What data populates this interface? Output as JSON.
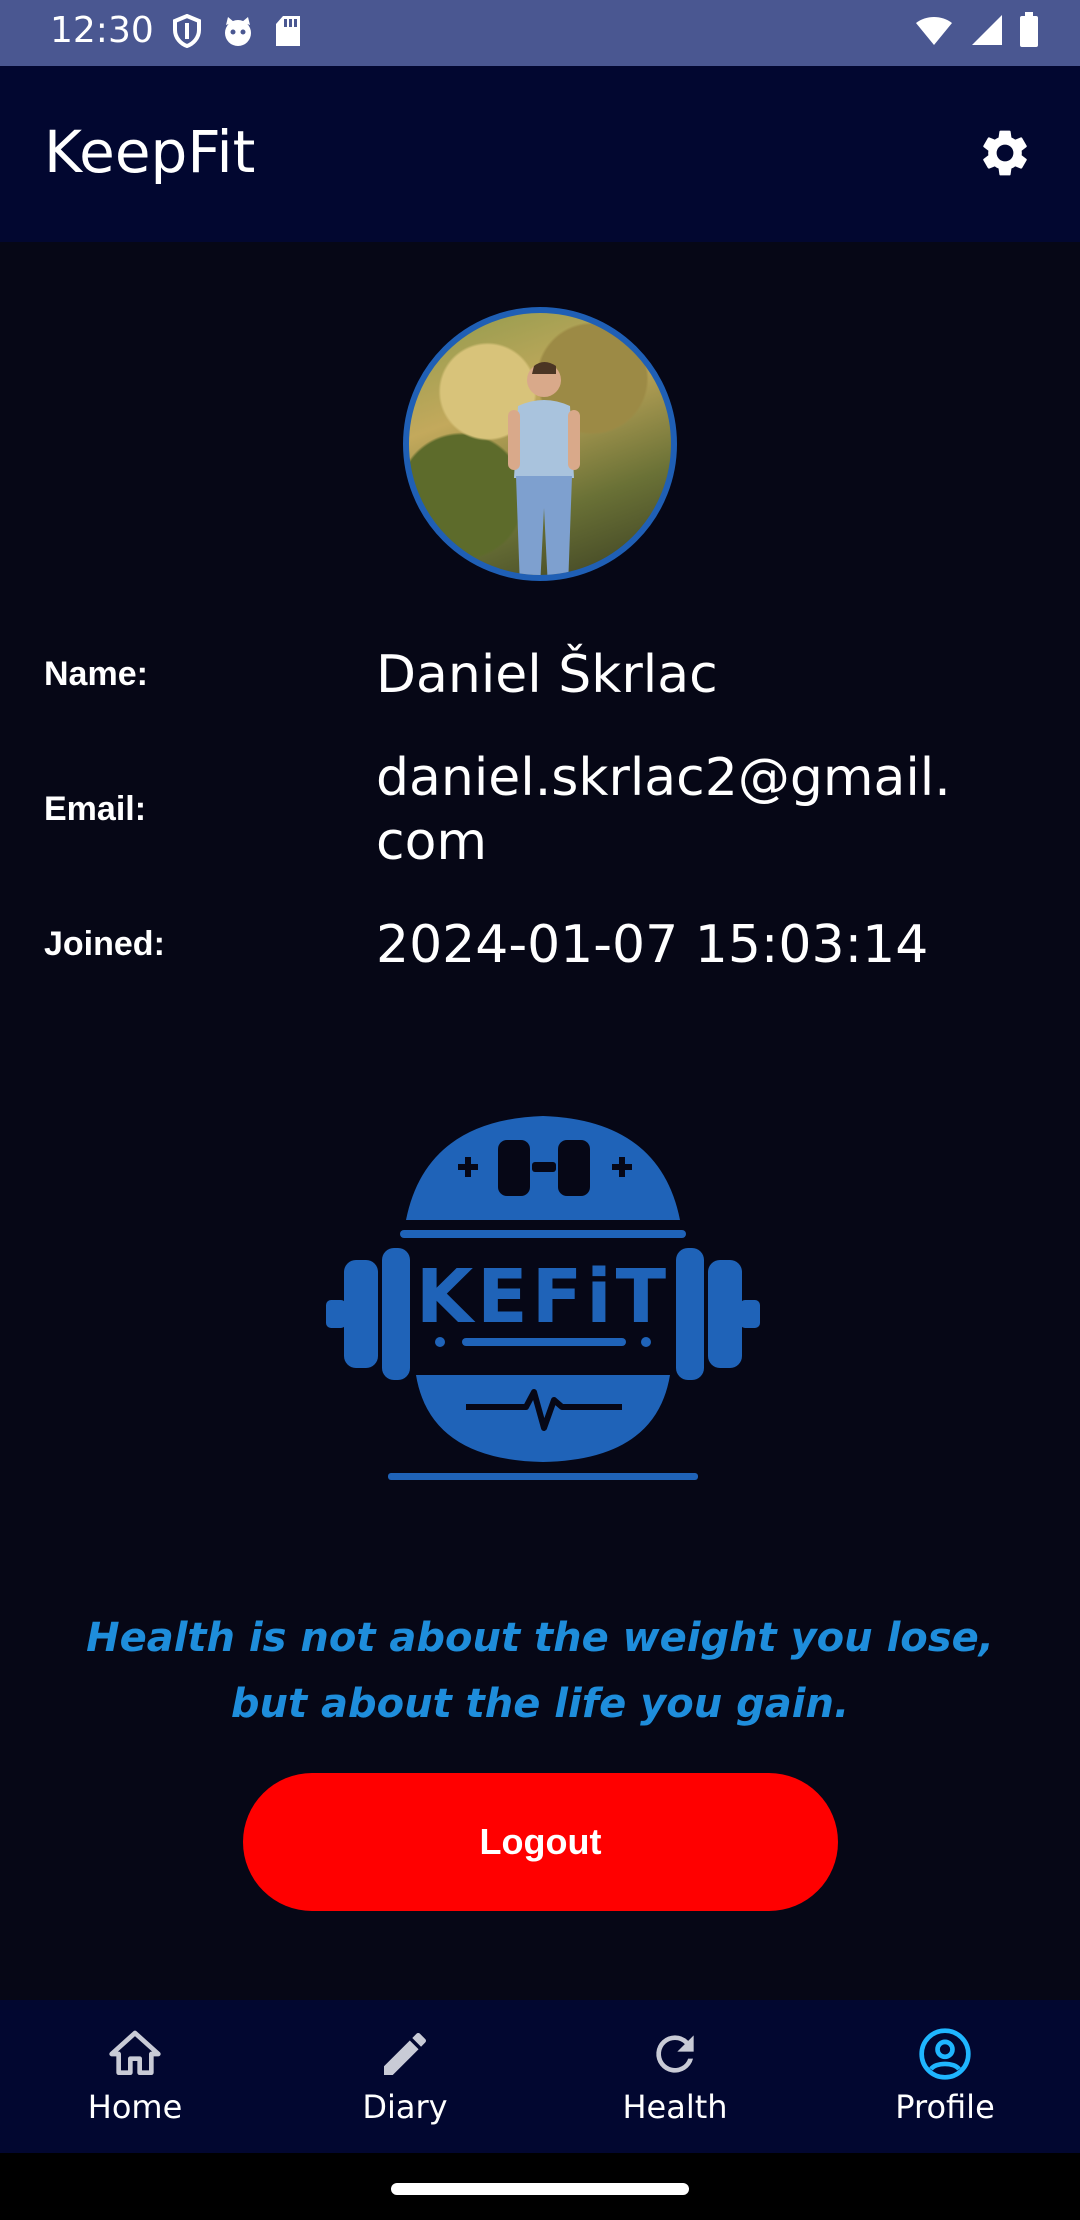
{
  "status_bar": {
    "time": "12:30"
  },
  "app_bar": {
    "title": "KeepFit"
  },
  "profile": {
    "name_label": "Name:",
    "name_value": "Daniel Škrlac",
    "email_label": "Email:",
    "email_value": "daniel.skrlac2@gmail.com",
    "joined_label": "Joined:",
    "joined_value": "2024-01-07 15:03:14"
  },
  "logo": {
    "text": "KEFiT"
  },
  "quote": "Health is not about the weight you lose, but about the life you gain.",
  "logout_label": "Logout",
  "bottom_nav": {
    "items": [
      {
        "label": "Home",
        "icon": "home-icon"
      },
      {
        "label": "Diary",
        "icon": "pencil-icon"
      },
      {
        "label": "Health",
        "icon": "refresh-icon"
      },
      {
        "label": "Profile",
        "icon": "account-circle-icon"
      }
    ],
    "active": "Profile"
  },
  "colors": {
    "status_bar": "#4a5791",
    "app_bar": "#020730",
    "background": "#060716",
    "accent_blue": "#1f5fb5",
    "quote": "#1e8ddb",
    "logout": "#ff0000",
    "active_nav": "#1fb6ff"
  }
}
